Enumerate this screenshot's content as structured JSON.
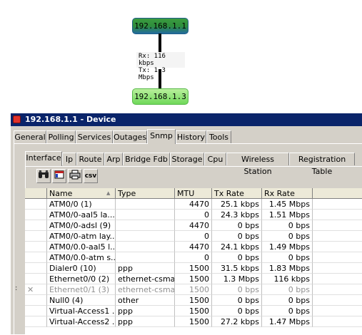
{
  "map": {
    "node_top": "192.168.1.1",
    "node_bottom": "192.168.1.3",
    "link_rx": "Rx: 116 kbps",
    "link_tx": "Tx: 1.3 Mbps"
  },
  "window": {
    "title": "192.168.1.1 - Device"
  },
  "tabs_main": [
    "General",
    "Polling",
    "Services",
    "Outages",
    "Snmp",
    "History",
    "Tools"
  ],
  "tabs_snmp": [
    "Interface",
    "Ip",
    "Route",
    "Arp",
    "Bridge Fdb",
    "Storage",
    "Cpu",
    "Wireless Station",
    "Registration Table"
  ],
  "toolbar": {
    "csv_label": "csv"
  },
  "grid": {
    "columns": [
      "Name",
      "Type",
      "MTU",
      "Tx Rate",
      "Rx Rate"
    ],
    "rows": [
      {
        "name": "ATM0/0 (1)",
        "type": "",
        "mtu": "4470",
        "tx": "25.1 kbps",
        "rx": "1.45 Mbps"
      },
      {
        "name": "ATM0/0-aal5 la...",
        "type": "",
        "mtu": "0",
        "tx": "24.3 kbps",
        "rx": "1.51 Mbps"
      },
      {
        "name": "ATM0/0-adsl (9)",
        "type": "",
        "mtu": "4470",
        "tx": "0 bps",
        "rx": "0 bps"
      },
      {
        "name": "ATM0/0-atm lay...",
        "type": "",
        "mtu": "0",
        "tx": "0 bps",
        "rx": "0 bps"
      },
      {
        "name": "ATM0/0.0-aal5 l...",
        "type": "",
        "mtu": "4470",
        "tx": "24.1 kbps",
        "rx": "1.49 Mbps"
      },
      {
        "name": "ATM0/0.0-atm s...",
        "type": "",
        "mtu": "0",
        "tx": "0 bps",
        "rx": "0 bps"
      },
      {
        "name": "Dialer0 (10)",
        "type": "ppp",
        "mtu": "1500",
        "tx": "31.5 kbps",
        "rx": "1.83 Mbps"
      },
      {
        "name": "Ethernet0/0 (2)",
        "type": "ethernet-csma...",
        "mtu": "1500",
        "tx": "1.3 Mbps",
        "rx": "116 kbps"
      },
      {
        "name": "Ethernet0/1 (3)",
        "type": "ethernet-csma...",
        "mtu": "1500",
        "tx": "0 bps",
        "rx": "0 bps",
        "disabled": true
      },
      {
        "name": "Null0 (4)",
        "type": "other",
        "mtu": "1500",
        "tx": "0 bps",
        "rx": "0 bps"
      },
      {
        "name": "Virtual-Access1 ...",
        "type": "ppp",
        "mtu": "1500",
        "tx": "0 bps",
        "rx": "0 bps"
      },
      {
        "name": "Virtual-Access2 ...",
        "type": "ppp",
        "mtu": "1500",
        "tx": "27.2 kbps",
        "rx": "1.47 Mbps"
      }
    ]
  },
  "colors": {
    "title_bar": "#0a246a",
    "node_top": "#2e8f3c",
    "node_bottom": "#6fd85a"
  }
}
